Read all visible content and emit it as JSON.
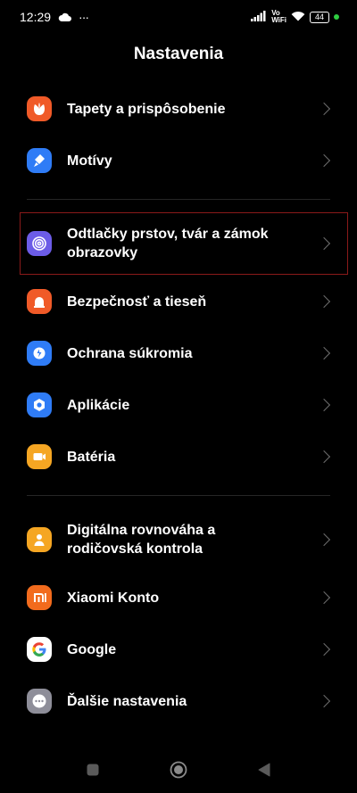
{
  "status_bar": {
    "time": "12:29",
    "overflow": "···",
    "volte_top": "Vo",
    "volte_bottom": "WiFi",
    "battery": "44",
    "icons": [
      "cloud-icon",
      "signal-bars-icon",
      "wifi-icon",
      "battery-icon"
    ],
    "dot_color": "#2ecc40"
  },
  "header": {
    "title": "Nastavenia"
  },
  "groups": [
    [
      {
        "name": "wallpaper",
        "label": "Tapety a prispôsobenie",
        "icon": "tulip-icon",
        "color": "#f05a28"
      },
      {
        "name": "themes",
        "label": "Motívy",
        "icon": "brush-icon",
        "color": "#2f7cf6"
      }
    ],
    [
      {
        "name": "fingerprint",
        "label": "Odtlačky prstov, tvár a zámok\nobrazovky",
        "icon": "fingerprint-icon",
        "color": "#6c5ce7",
        "highlighted": true
      },
      {
        "name": "security",
        "label": "Bezpečnosť a tieseň",
        "icon": "siren-icon",
        "color": "#f05a28"
      },
      {
        "name": "privacy",
        "label": "Ochrana súkromia",
        "icon": "shield-icon",
        "color": "#2f7cf6"
      },
      {
        "name": "apps",
        "label": "Aplikácie",
        "icon": "gear-hex-icon",
        "color": "#2f7cf6"
      },
      {
        "name": "battery",
        "label": "Batéria",
        "icon": "battery-icon",
        "color": "#f5a623"
      }
    ],
    [
      {
        "name": "wellbeing",
        "label": "Digitálna rovnováha a\nrodičovská kontrola",
        "icon": "person-icon",
        "color": "#f5a623"
      },
      {
        "name": "xiaomi-account",
        "label": "Xiaomi Konto",
        "icon": "mi-logo-icon",
        "color": "#f26b1d"
      },
      {
        "name": "google",
        "label": "Google",
        "icon": "google-g-icon",
        "color": "#ffffff"
      },
      {
        "name": "more-settings",
        "label": "Ďalšie nastavenia",
        "icon": "more-dots-icon",
        "color": "#8e8e99"
      }
    ]
  ],
  "nav_bar": {
    "buttons": [
      "recents-square-icon",
      "home-circle-icon",
      "back-triangle-icon"
    ]
  }
}
